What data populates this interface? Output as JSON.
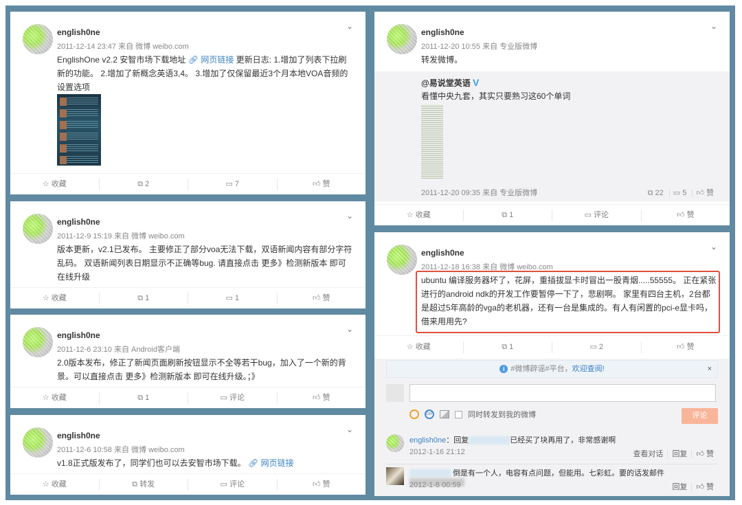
{
  "common": {
    "author": "english0ne",
    "chevron": "⌄",
    "fav": "收藏",
    "like": "赞",
    "comment": "评论",
    "forward": "转发",
    "link_label": "网页链接"
  },
  "posts": [
    {
      "meta": "2011-12-14 23:47 来自 微博 weibo.com",
      "text_a": "EnglishOne v2.2 安智市场下载地址 ",
      "text_b": " 更新日志: 1.增加了列表下拉刷新的功能。 2.增加了新概念英语3,4。 3.增加了仅保留最近3个月本地VOA音频的设置选项",
      "forward_count": "2",
      "comment_count": "7"
    },
    {
      "meta": "2011-12-9 15:19 来自 微博 weibo.com",
      "text": "版本更新，v2.1已发布。 主要修正了部分voa无法下载，双语新闻内容有部分字符乱码。 双语新闻列表日期显示不正确等bug. 请直接点击 更多》检测新版本 即可在线升级",
      "forward_count": "1",
      "comment_count": "1"
    },
    {
      "meta": "2011-12-6 23:10 来自 Android客户端",
      "text": "2.0版本发布，修正了新闻页面刷新按钮显示不全等若干bug，加入了一个新的背景。可以直接点击 更多》检测新版本 即可在线升级。；》",
      "forward_count": "1"
    },
    {
      "meta": "2011-12-6 10:58 来自 微博 weibo.com",
      "text_a": "v1.8正式版发布了，同学们也可以去安智市场下载。 "
    },
    {
      "meta": "2011-12-20 10:55 来自 专业版微博",
      "text": "转发微博。",
      "forward_count": "1",
      "repost": {
        "author": "@易说堂英语",
        "verified": "V",
        "text": "看懂中央九套，其实只要熟习这60个单词",
        "meta": "2011-12-20 09:35 来自 专业版微博",
        "forward_count": "22",
        "comment_count": "5"
      }
    },
    {
      "meta": "2011-12-18 16:38 来自 微博 weibo.com",
      "text": "ubuntu 编译服务器坏了，花屏，重插拔显卡时冒出一股青烟.....55555。 正在紧张进行的android ndk的开发工作要暂停一下了，悲剧啊。 家里有四台主机，2台都是超过5年高龄的vga的老机器，还有一台是集成的。有人有闲置的pci-e显卡吗，借来用用先?",
      "forward_count": "1",
      "comment_count": "2",
      "comments_panel": {
        "notice": "#微博辟谣#平台，",
        "notice_link": "欢迎查阅!",
        "close": "×",
        "sync_label": "同时转发到我的微博",
        "submit": "评论",
        "items": [
          {
            "user": "english0ne",
            "text_a": "：回复",
            "text_b": "已经买了块再用了，非常感谢啊",
            "time": "2012-1-16 21:12",
            "view": "查看对话",
            "reply": "回复",
            "like": "赞"
          },
          {
            "text_a": "倒是有一个人，电容有点问题，但能用。七彩虹。要的话发邮件",
            "time": "2012-1-8 00:59",
            "reply": "回复",
            "like": "赞"
          }
        ]
      }
    }
  ]
}
